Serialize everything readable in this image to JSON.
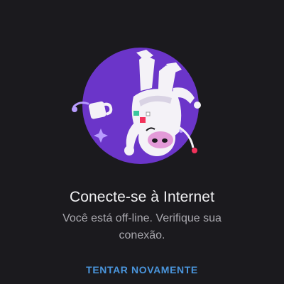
{
  "offline": {
    "title": "Conecte-se à Internet",
    "message": "Você está off-line. Verifique sua conexão.",
    "retry_label": "TENTAR NOVAMENTE"
  },
  "colors": {
    "background": "#1b1a1e",
    "accent_purple": "#6b35c9",
    "link_blue": "#4a95dc",
    "title_text": "#f1f1f3",
    "message_text": "#a9a8ae"
  },
  "icons": {
    "illustration": "floating-astronaut-pig-illustration"
  }
}
